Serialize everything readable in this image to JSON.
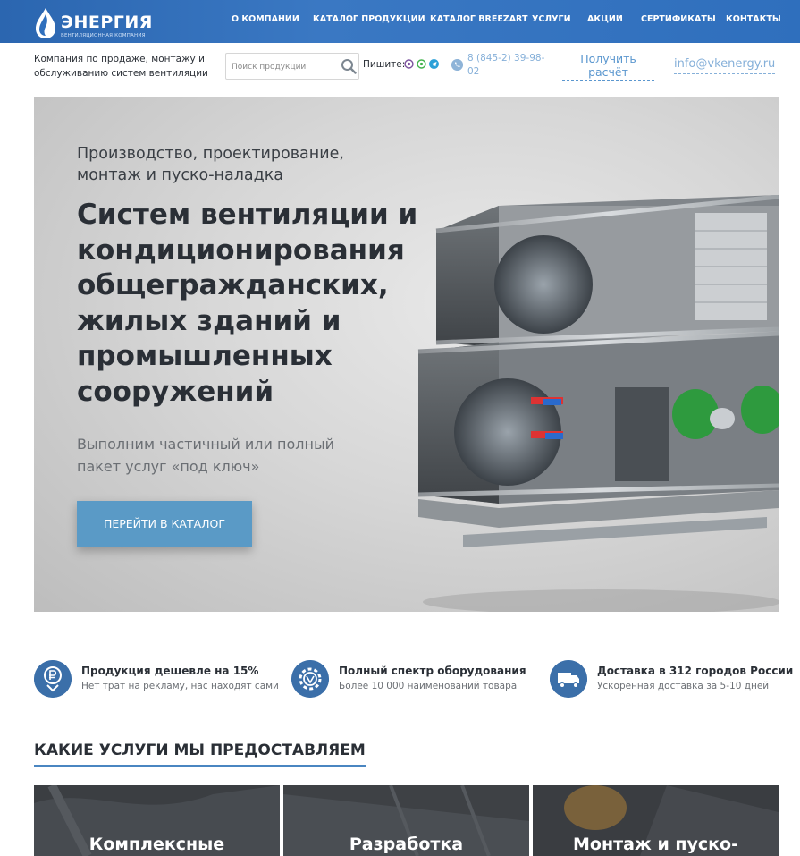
{
  "brand": {
    "name": "ЭНЕРГИЯ",
    "subtitle": "ВЕНТИЛЯЦИОННАЯ КОМПАНИЯ"
  },
  "nav": {
    "items": [
      {
        "label": "О КОМПАНИИ"
      },
      {
        "label": "КАТАЛОГ ПРОДУКЦИИ"
      },
      {
        "label": "КАТАЛОГ BREEZART"
      },
      {
        "label": "УСЛУГИ"
      },
      {
        "label": "АКЦИИ"
      },
      {
        "label": "СЕРТИФИКАТЫ"
      },
      {
        "label": "КОНТАКТЫ"
      }
    ]
  },
  "header": {
    "company_desc": "Компания по продаже, монтажу и обслуживанию систем вентиляции",
    "search_placeholder": "Поиск продукции",
    "write_label": "Пишите:",
    "messengers": [
      "viber-icon",
      "whatsapp-icon",
      "telegram-icon"
    ],
    "phone": "8 (845-2) 39-98-02",
    "calc_label": "Получить расчёт",
    "email": "info@vkenergy.ru"
  },
  "hero": {
    "subtitle": "Производство, проектирование, монтаж и пуско-наладка",
    "title": "Систем вентиляции и кондиционирования общегражданских, жилых зданий и промышленных сооружений",
    "description": "Выполним частичный или полный пакет услуг «под ключ»",
    "button_label": "ПЕРЕЙТИ В КАТАЛОГ"
  },
  "features": [
    {
      "icon": "ruble-icon",
      "title": "Продукция дешевле на 15%",
      "text": "Нет трат на рекламу, нас находят сами"
    },
    {
      "icon": "gear-icon",
      "title": "Полный спектр оборудования",
      "text": "Более 10 000 наименований товара"
    },
    {
      "icon": "truck-icon",
      "title": "Доставка в 312 городов России",
      "text": "Ускоренная доставка за 5-10 дней"
    }
  ],
  "services": {
    "title": "КАКИЕ УСЛУГИ МЫ ПРЕДОСТАВЛЯЕМ",
    "items": [
      {
        "label": "Комплексные"
      },
      {
        "label": "Разработка"
      },
      {
        "label": "Монтаж и пуско-"
      }
    ]
  },
  "colors": {
    "nav_bg": "#2f6fbd",
    "accent": "#5a9ac6",
    "link": "#86b0d9",
    "feature_icon": "#3b6fa9"
  }
}
